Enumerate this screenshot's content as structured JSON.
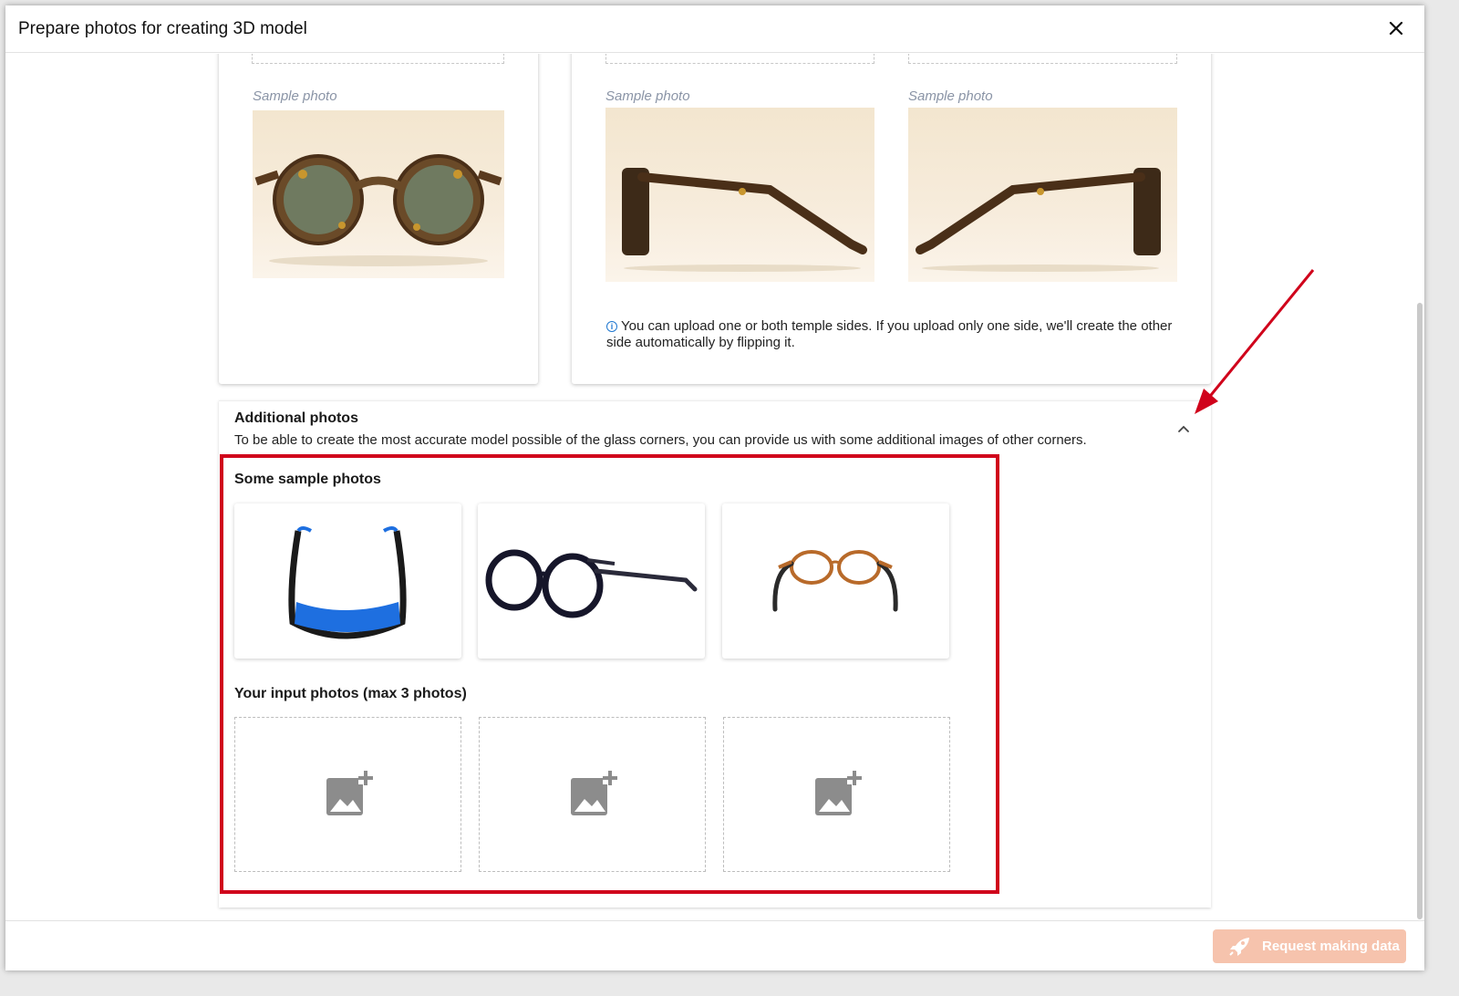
{
  "dialog": {
    "title": "Prepare photos for creating 3D model",
    "close_icon": "close-icon"
  },
  "front_card": {
    "sample_label": "Sample photo"
  },
  "temple_card": {
    "left_sample_label": "Sample photo",
    "right_sample_label": "Sample photo",
    "info_icon": "info-icon",
    "info_text": "You can upload one or both temple sides. If you upload only one side, we'll create the other side automatically by flipping it."
  },
  "additional": {
    "title": "Additional photos",
    "description": "To be able to create the most accurate model possible of the glass corners, you can provide us with some additional images of other corners.",
    "collapse_icon": "chevron-up-icon",
    "samples_title": "Some sample photos",
    "inputs_title": "Your input photos (max 3 photos)",
    "upload_icon": "add-photo-icon"
  },
  "footer": {
    "request_button": "Request making data",
    "request_icon": "rocket-icon"
  },
  "colors": {
    "highlight": "#d0021b",
    "request_button_bg": "#f6c3ad",
    "info_icon": "#1f77d0"
  }
}
